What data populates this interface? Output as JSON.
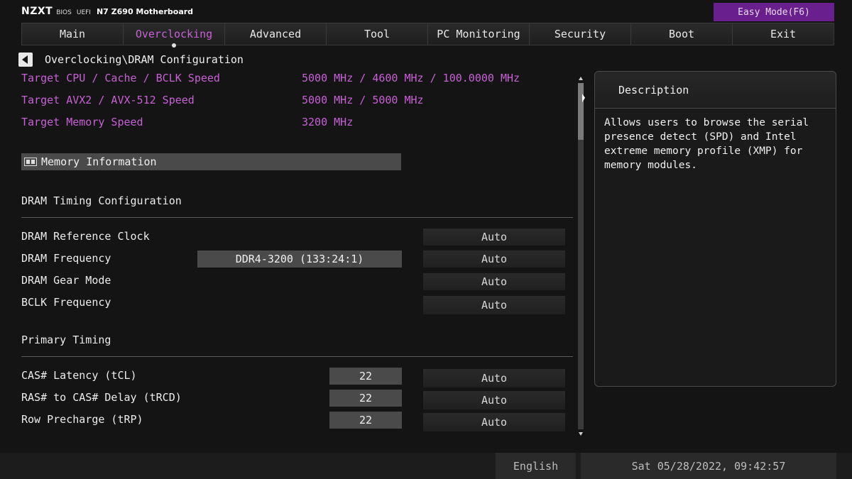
{
  "header": {
    "brand_logo": "NZXT",
    "brand_bios": "BIOS",
    "brand_uefi": "UEFI",
    "brand_model": "N7 Z690 Motherboard",
    "easy_mode_label": "Easy Mode(F6)"
  },
  "tabs": [
    {
      "label": "Main",
      "active": false
    },
    {
      "label": "Overclocking",
      "active": true
    },
    {
      "label": "Advanced",
      "active": false
    },
    {
      "label": "Tool",
      "active": false
    },
    {
      "label": "PC Monitoring",
      "active": false
    },
    {
      "label": "Security",
      "active": false
    },
    {
      "label": "Boot",
      "active": false
    },
    {
      "label": "Exit",
      "active": false
    }
  ],
  "breadcrumb": "Overclocking\\DRAM Configuration",
  "targets": [
    {
      "label": "Target CPU / Cache / BCLK Speed",
      "value": "5000 MHz / 4600 MHz / 100.0000 MHz"
    },
    {
      "label": "Target AVX2 / AVX-512 Speed",
      "value": "5000 MHz / 5000 MHz"
    },
    {
      "label": "Target Memory Speed",
      "value": "3200 MHz"
    }
  ],
  "memory_information_label": "Memory Information",
  "dram_timing": {
    "title": "DRAM Timing Configuration",
    "rows": [
      {
        "label": "DRAM Reference Clock",
        "current": "",
        "setting": "Auto"
      },
      {
        "label": "DRAM Frequency",
        "current": "DDR4-3200 (133:24:1)",
        "setting": "Auto"
      },
      {
        "label": "DRAM Gear Mode",
        "current": "",
        "setting": "Auto"
      },
      {
        "label": "BCLK Frequency",
        "current": "",
        "setting": "Auto"
      }
    ]
  },
  "primary_timing": {
    "title": "Primary Timing",
    "rows": [
      {
        "label": "CAS# Latency (tCL)",
        "current": "22",
        "setting": "Auto"
      },
      {
        "label": "RAS# to CAS# Delay (tRCD)",
        "current": "22",
        "setting": "Auto"
      },
      {
        "label": "Row Precharge (tRP)",
        "current": "22",
        "setting": "Auto"
      }
    ]
  },
  "description": {
    "title": "Description",
    "lines": [
      "Allows users to browse the serial",
      "presence detect (SPD) and Intel",
      "extreme memory profile (XMP) for",
      "memory modules."
    ]
  },
  "footer": {
    "language": "English",
    "datetime": "Sat 05/28/2022, 09:42:57"
  },
  "colors": {
    "accent": "#c860d6",
    "easy_mode_bg": "#6a1f8e"
  }
}
